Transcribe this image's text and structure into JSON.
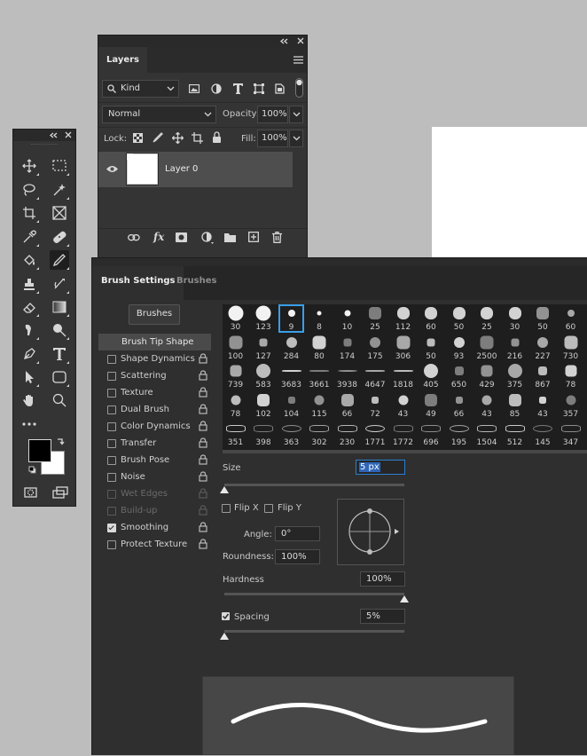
{
  "layers_panel": {
    "tab": "Layers",
    "filter_kind": "Kind",
    "blend_mode": "Normal",
    "opacity_label": "Opacity:",
    "opacity_value": "100%",
    "lock_label": "Lock:",
    "fill_label": "Fill:",
    "fill_value": "100%",
    "layer_name": "Layer 0"
  },
  "brush_settings": {
    "tab_active": "Brush Settings",
    "tab_inactive": "Brushes",
    "brushes_button": "Brushes",
    "options": [
      {
        "label": "Brush Tip Shape",
        "checkbox": false,
        "lock": false,
        "checked": false,
        "disabled": false,
        "header": true
      },
      {
        "label": "Shape Dynamics",
        "checkbox": true,
        "lock": true,
        "checked": false,
        "disabled": false
      },
      {
        "label": "Scattering",
        "checkbox": true,
        "lock": true,
        "checked": false,
        "disabled": false
      },
      {
        "label": "Texture",
        "checkbox": true,
        "lock": true,
        "checked": false,
        "disabled": false
      },
      {
        "label": "Dual Brush",
        "checkbox": true,
        "lock": true,
        "checked": false,
        "disabled": false
      },
      {
        "label": "Color Dynamics",
        "checkbox": true,
        "lock": true,
        "checked": false,
        "disabled": false
      },
      {
        "label": "Transfer",
        "checkbox": true,
        "lock": true,
        "checked": false,
        "disabled": false
      },
      {
        "label": "Brush Pose",
        "checkbox": true,
        "lock": true,
        "checked": false,
        "disabled": false
      },
      {
        "label": "Noise",
        "checkbox": true,
        "lock": true,
        "checked": false,
        "disabled": false
      },
      {
        "label": "Wet Edges",
        "checkbox": true,
        "lock": true,
        "checked": false,
        "disabled": true
      },
      {
        "label": "Build-up",
        "checkbox": true,
        "lock": true,
        "checked": false,
        "disabled": true
      },
      {
        "label": "Smoothing",
        "checkbox": true,
        "lock": true,
        "checked": true,
        "disabled": false
      },
      {
        "label": "Protect Texture",
        "checkbox": true,
        "lock": true,
        "checked": false,
        "disabled": false
      }
    ],
    "tip_sizes": [
      [
        "30",
        "123",
        "9",
        "8",
        "10",
        "25",
        "112",
        "60",
        "50",
        "25",
        "30",
        "50",
        "60"
      ],
      [
        "100",
        "127",
        "284",
        "80",
        "174",
        "175",
        "306",
        "50",
        "93",
        "2500",
        "216",
        "227",
        "730"
      ],
      [
        "739",
        "583",
        "3683",
        "3661",
        "3938",
        "4647",
        "1818",
        "405",
        "650",
        "429",
        "375",
        "867",
        "78"
      ],
      [
        "78",
        "102",
        "104",
        "115",
        "66",
        "72",
        "43",
        "49",
        "66",
        "43",
        "85",
        "43",
        "357"
      ],
      [
        "351",
        "398",
        "363",
        "302",
        "230",
        "1771",
        "1772",
        "696",
        "195",
        "1504",
        "512",
        "145",
        "347"
      ]
    ],
    "selected_tip": "9",
    "size_label": "Size",
    "size_value": "5 px",
    "size_fraction": 0.0,
    "flip_x_label": "Flip X",
    "flip_y_label": "Flip Y",
    "angle_label": "Angle:",
    "angle_value": "0°",
    "roundness_label": "Roundness:",
    "roundness_value": "100%",
    "hardness_label": "Hardness",
    "hardness_value": "100%",
    "hardness_fraction": 1.0,
    "spacing_label": "Spacing",
    "spacing_value": "5%",
    "spacing_checked": true,
    "spacing_fraction": 0.0
  }
}
